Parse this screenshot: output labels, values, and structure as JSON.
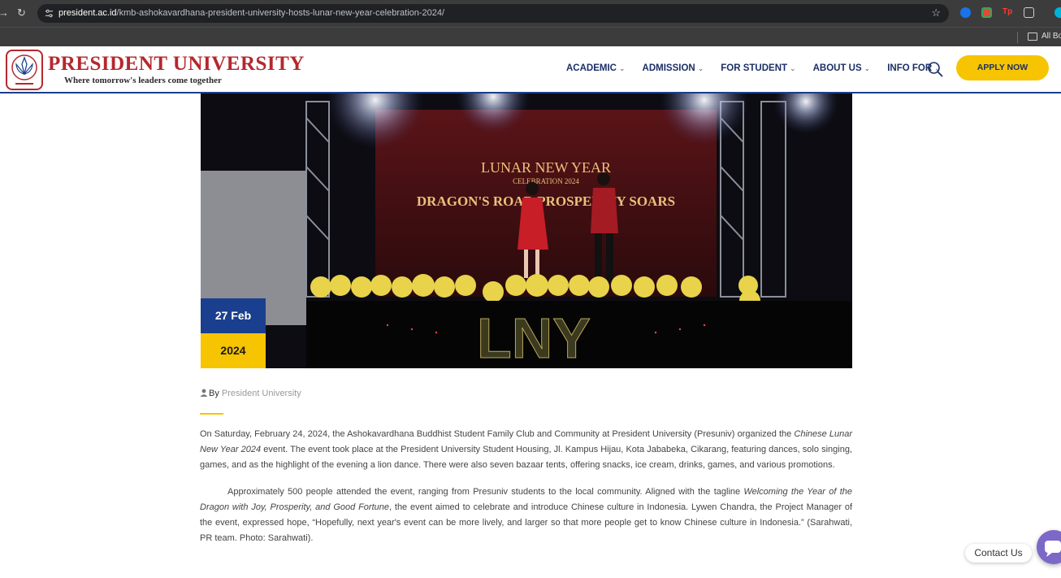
{
  "browser": {
    "url_domain": "president.ac.id",
    "url_path": "/kmb-ashokavardhana-president-university-hosts-lunar-new-year-celebration-2024/",
    "bookmarks_label": "All Bo"
  },
  "header": {
    "logo_title": "PRESIDENT UNIVERSITY",
    "logo_tagline": "Where tomorrow's leaders come together",
    "nav": [
      {
        "label": "ACADEMIC"
      },
      {
        "label": "ADMISSION"
      },
      {
        "label": "FOR STUDENT"
      },
      {
        "label": "ABOUT US"
      },
      {
        "label": "INFO FOR"
      }
    ],
    "cta_label": "APPLY NOW",
    "colors": {
      "brand_red": "#b5282e",
      "navy": "#1b3f8f",
      "yellow": "#f6c400"
    }
  },
  "hero": {
    "banner_line1": "LUNAR NEW YEAR",
    "banner_line2": "CELEBRATION 2024",
    "banner_line3": "DRAGON'S ROAR PROSPERITY SOARS",
    "stage_letters": "LNY"
  },
  "post": {
    "date_day": "27 Feb",
    "date_year": "2024",
    "by_label": "By",
    "author": "President University",
    "p1_a": "On Saturday, February 24, 2024, the Ashokavardhana Buddhist Student Family Club and Community at President University (Presuniv) organized the ",
    "p1_em": "Chinese Lunar New Year 2024",
    "p1_b": " event. The event took place at the President University Student Housing, Jl. Kampus Hijau, Kota Jababeka, Cikarang, featuring dances, solo singing, games, and as the highlight of the evening a lion dance. There were also seven bazaar tents, offering snacks, ice cream, drinks, games, and various promotions.",
    "p2_a": "Approximately 500 people attended the event, ranging from Presuniv students to the local community. Aligned with the tagline ",
    "p2_em": "Welcoming the Year of the Dragon with Joy, Prosperity, and Good Fortune",
    "p2_b": ", the event aimed to celebrate and introduce Chinese culture in Indonesia. Lywen Chandra, the Project Manager of the event, expressed hope, “Hopefully, next year's event can be more lively, and larger so that more people get to know Chinese culture in Indonesia.” (Sarahwati, PR team. Photo: Sarahwati)."
  },
  "widget": {
    "contact_label": "Contact Us"
  }
}
